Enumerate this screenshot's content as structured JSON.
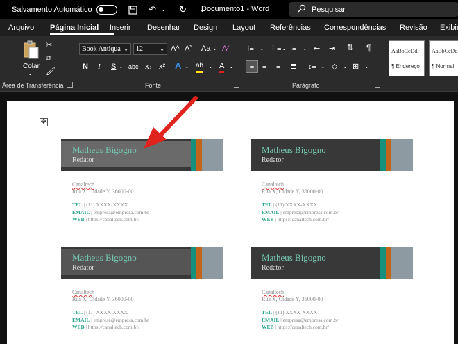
{
  "titlebar": {
    "autosave_label": "Salvamento Automático",
    "doc_title": "Documento1  -  Word",
    "search_placeholder": "Pesquisar"
  },
  "tabs": [
    "Arquivo",
    "Página Inicial",
    "Inserir",
    "Desenhar",
    "Design",
    "Layout",
    "Referências",
    "Correspondências",
    "Revisão",
    "Exibir"
  ],
  "active_tab": "Página Inicial",
  "ribbon": {
    "paste_label": "Colar",
    "clipboard_group": "Área de Transferência",
    "font_group": "Fonte",
    "paragraph_group": "Parágrafo",
    "font_name": "Book Antiqua",
    "font_size": "12",
    "bold": "N",
    "italic": "I",
    "underline": "S",
    "strike": "abc",
    "subscript": "x₂",
    "superscript": "x²",
    "grow_font": "A^",
    "shrink_font": "Aˇ",
    "change_case": "Aa",
    "text_effects": "A",
    "highlight": "ab",
    "font_color": "A",
    "pilcrow": "¶",
    "style1_sample": "AaBbCcDdl",
    "style1_name": "¶ Endereço",
    "style2_sample": "AaBbCcDdl",
    "style2_name": "¶ Normal"
  },
  "cards": [
    {
      "name": "Matheus Bigogno",
      "role": "Redator",
      "company": "Canaltech",
      "address": "Rua X, Cidade Y, 36000-00",
      "tel_key": "TEL",
      "tel": "(11) XXXX-XXXX",
      "email_key": "EMAIL",
      "email": "empresa@empresa.com.br",
      "web_key": "WEB",
      "web": "https://canaltech.com.br/"
    },
    {
      "name": "Matheus Bigogno",
      "role": "Redator",
      "company": "Canaltech",
      "address": "Rua X, Cidade Y, 36000-00",
      "tel_key": "TEL",
      "tel": "(11) XXXX-XXXX",
      "email_key": "EMAIL",
      "email": "empresa@empresa.com.br",
      "web_key": "WEB",
      "web": "https://canaltech.com.br/"
    },
    {
      "name": "Matheus Bigogno",
      "role": "Redator",
      "company": "Canaltech",
      "address": "Rua X, Cidade Y, 36000-00",
      "tel_key": "TEL",
      "tel": "(11) XXXX-XXXX",
      "email_key": "EMAIL",
      "email": "empresa@empresa.com.br",
      "web_key": "WEB",
      "web": "https://canaltech.com.br/"
    },
    {
      "name": "Matheus Bigogno",
      "role": "Redator",
      "company": "Canaltech",
      "address": "Rua X, Cidade Y, 36000-00",
      "tel_key": "TEL",
      "tel": "(11) XXXX-XXXX",
      "email_key": "EMAIL",
      "email": "empresa@empresa.com.br",
      "web_key": "WEB",
      "web": "https://canaltech.com.br/"
    }
  ],
  "colors": {
    "banner": "#383838",
    "name_text": "#74c7b1",
    "teal_stripe": "#168f7d",
    "orange_stripe": "#c0651b",
    "grey_stripe": "#8e9aa1",
    "arrow": "#e0231c"
  }
}
